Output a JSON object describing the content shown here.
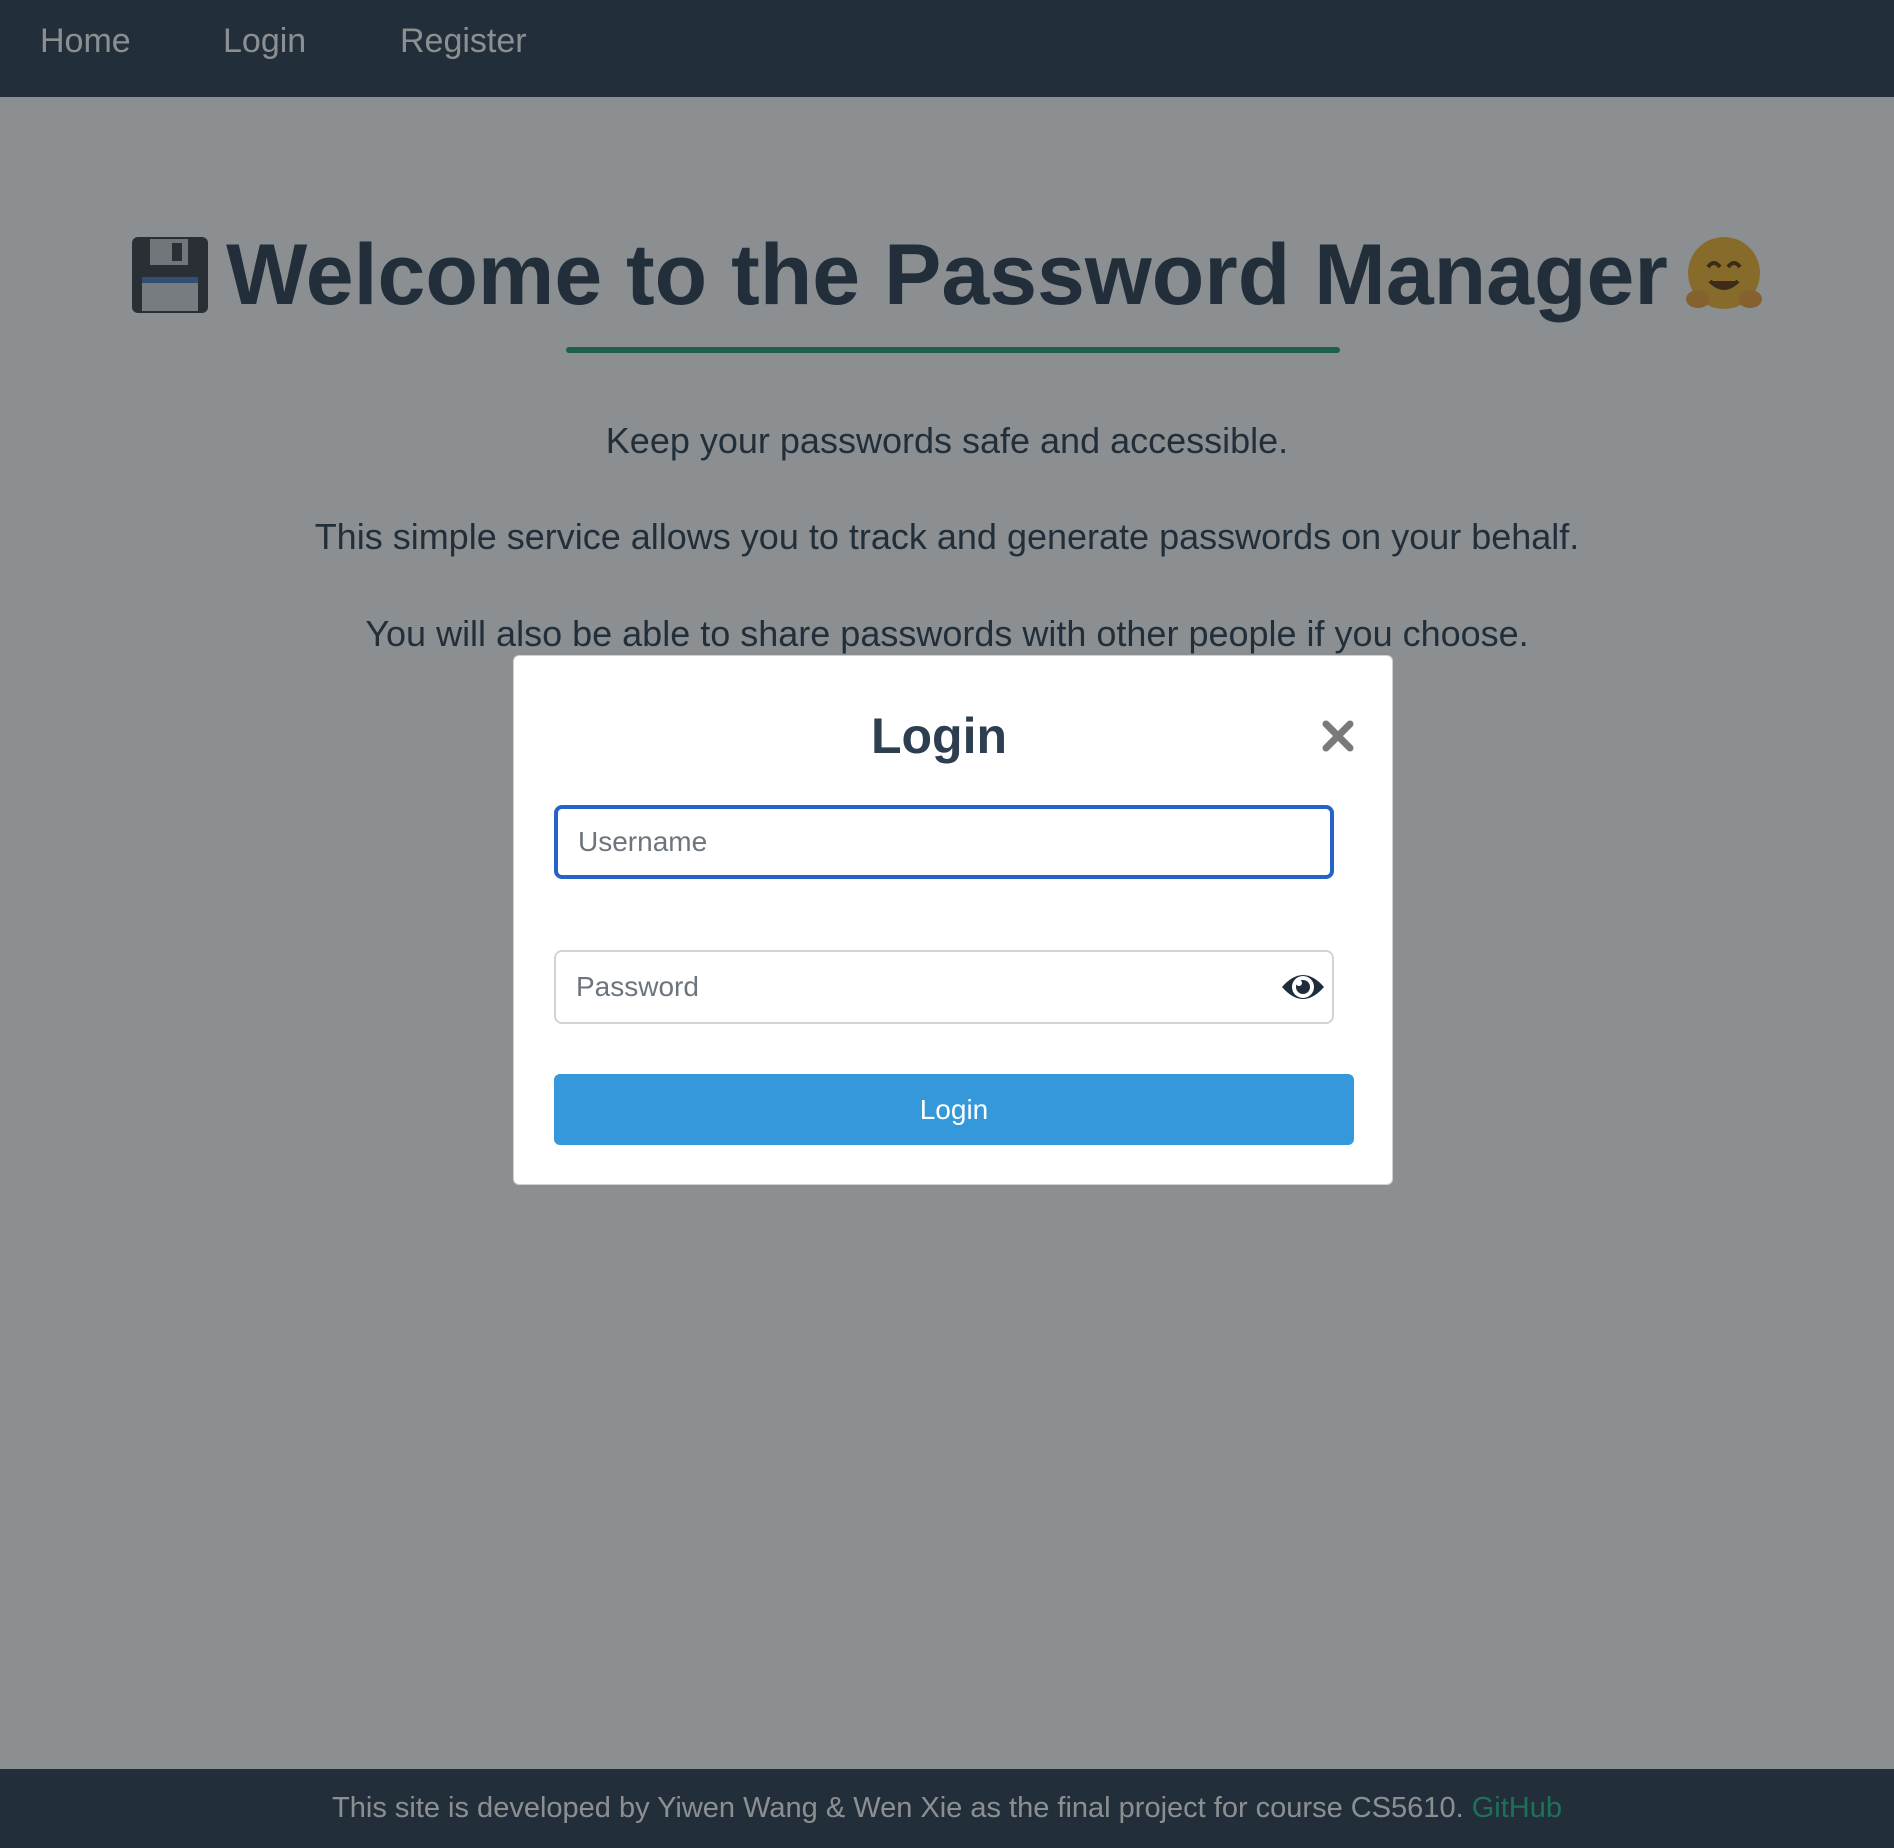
{
  "nav": {
    "items": [
      {
        "label": "Home"
      },
      {
        "label": "Login"
      },
      {
        "label": "Register"
      }
    ]
  },
  "hero": {
    "title": "Welcome to the Password Manager",
    "left_icon": "floppy-disk-icon",
    "right_icon": "hugging-face-icon",
    "paragraphs": [
      "Keep your passwords safe and accessible.",
      "This simple service allows you to track and generate passwords on your behalf.",
      "You will also be able to share passwords with other people if you choose."
    ]
  },
  "modal": {
    "title": "Login",
    "username_placeholder": "Username",
    "password_placeholder": "Password",
    "submit_label": "Login",
    "close_icon": "close-icon",
    "eye_icon": "eye-icon"
  },
  "footer": {
    "text": "This site is developed by Yiwen Wang & Wen Xie as the final project for course CS5610.",
    "link_label": "GitHub"
  },
  "colors": {
    "navbar": "#2c3e50",
    "accent_green": "#23a076",
    "button_blue": "#3498db",
    "focus_blue": "#2563c9",
    "heading_text": "#2c3e50"
  }
}
